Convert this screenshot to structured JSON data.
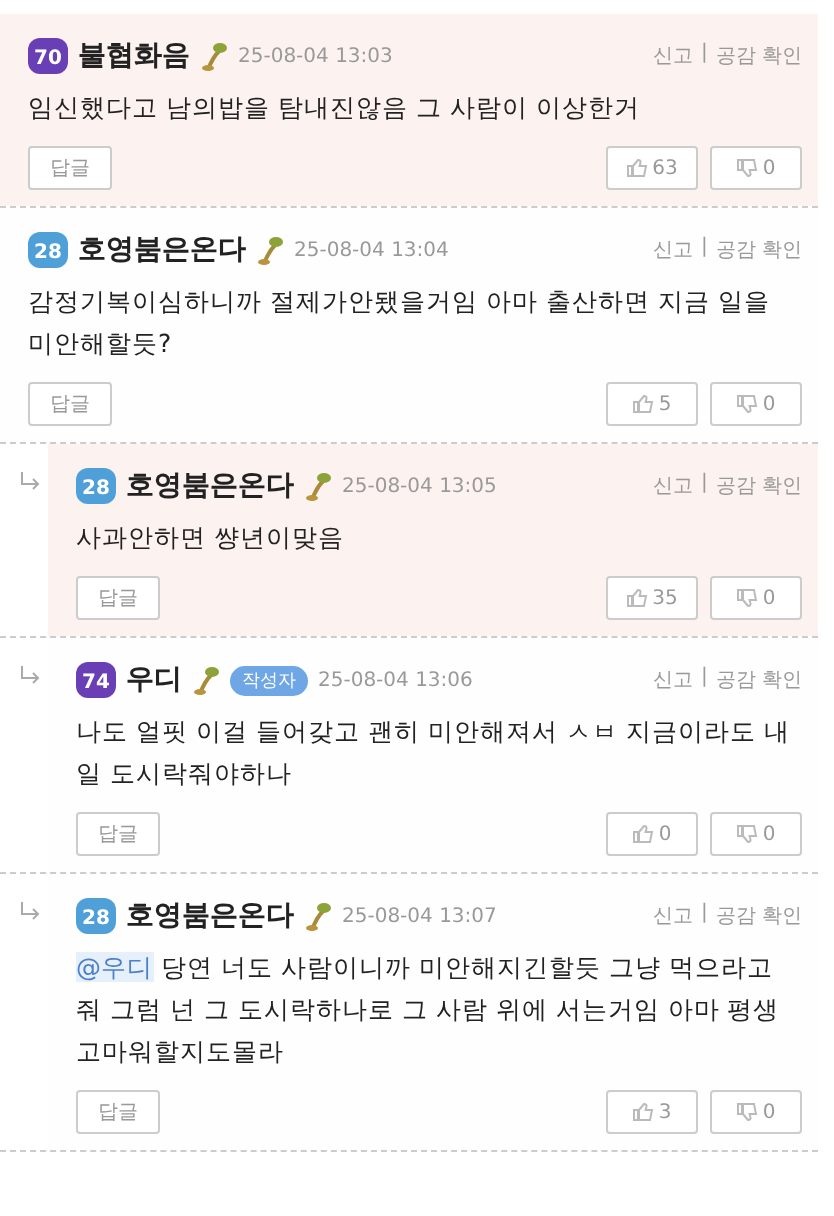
{
  "comments": [
    {
      "level": "70",
      "color": "#6a3fb5",
      "author": "불협화음",
      "time": "25-08-04 13:03",
      "report": "신고",
      "separator": "|",
      "empathy": "공감 확인",
      "text": "임신했다고 남의밥을 탐내진않음 그 사람이 이상한거",
      "reply_button": "답글",
      "likes": "63",
      "dislikes": "0",
      "reply": false,
      "highlighted": true
    },
    {
      "level": "28",
      "color": "#4f9fd8",
      "author": "호영붐은온다",
      "time": "25-08-04 13:04",
      "report": "신고",
      "separator": "|",
      "empathy": "공감 확인",
      "text": "감정기복이심하니까 절제가안됐을거임 아마 출산하면 지금 일을 미안해할듯?",
      "reply_button": "답글",
      "likes": "5",
      "dislikes": "0",
      "reply": false,
      "highlighted": false
    },
    {
      "level": "28",
      "color": "#4f9fd8",
      "author": "호영붐은온다",
      "time": "25-08-04 13:05",
      "report": "신고",
      "separator": "|",
      "empathy": "공감 확인",
      "text": "사과안하면 썅년이맞음",
      "reply_button": "답글",
      "likes": "35",
      "dislikes": "0",
      "reply": true,
      "highlighted": true
    },
    {
      "level": "74",
      "color": "#6a3fb5",
      "author": "우디",
      "author_tag": "작성자",
      "time": "25-08-04 13:06",
      "report": "신고",
      "separator": "|",
      "empathy": "공감 확인",
      "text": "나도 얼핏 이걸 들어갖고 괜히 미안해져서 ㅅㅂ 지금이라도 내일 도시락줘야하나",
      "reply_button": "답글",
      "likes": "0",
      "dislikes": "0",
      "reply": true,
      "highlighted": false
    },
    {
      "level": "28",
      "color": "#4f9fd8",
      "author": "호영붐은온다",
      "time": "25-08-04 13:07",
      "report": "신고",
      "separator": "|",
      "empathy": "공감 확인",
      "mention": "@우디",
      "text": "당연 너도 사람이니까 미안해지긴할듯 그냥 먹으라고 줘 그럼 넌 그 도시락하나로 그 사람 위에 서는거임 아마 평생고마워할지도몰라",
      "reply_button": "답글",
      "likes": "3",
      "dislikes": "0",
      "reply": true,
      "highlighted": false
    }
  ]
}
